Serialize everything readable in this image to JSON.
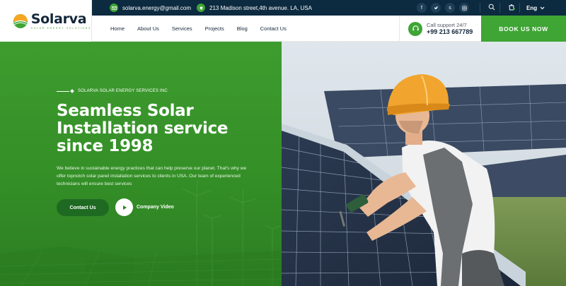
{
  "brand": {
    "name": "Solarva",
    "tagline": "SOLAR ENERGY SOLUTIONS",
    "colors": {
      "green": "#3fa535",
      "navy": "#0c2a40",
      "dark_green": "#1f6a22"
    }
  },
  "topbar": {
    "email": "solarva.energy@gmail.com",
    "email_icon": "mail-icon",
    "address": "213 Madison street,4th avenue. LA, USA",
    "address_icon": "map-pin-icon",
    "social": [
      "facebook-icon",
      "twitter-icon",
      "skype-icon",
      "instagram-icon"
    ],
    "language": "Eng"
  },
  "nav": {
    "links": [
      "Home",
      "About Us",
      "Services",
      "Projects",
      "Blog",
      "Contact Us"
    ],
    "support_label": "Call support 24/7",
    "support_phone": "+99 213 667789",
    "book_label": "BOOK US NOW"
  },
  "hero": {
    "eyebrow": "SOLARVA SOLAR ENERGY SERVICES INC",
    "title_line1": "Seamless Solar",
    "title_line2": "Installation service",
    "title_line3": "since 1998",
    "description": "We believe in sustainable energy practices that can help preserve our planet. That's why we offer topnotch solar panel installation services to clients in USA. Our team of experienced technicians will ensure best services",
    "contact_label": "Contact Us",
    "video_label": "Company Video"
  }
}
